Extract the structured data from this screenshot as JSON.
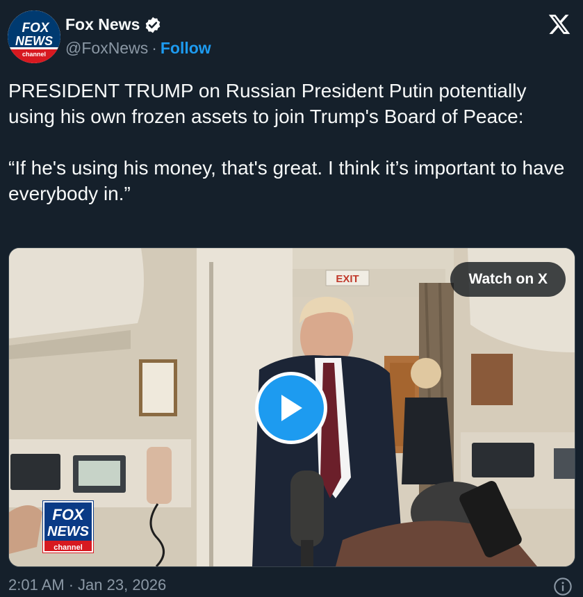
{
  "author": {
    "name": "Fox News",
    "handle": "@FoxNews",
    "separator": "·",
    "follow_label": "Follow",
    "avatar_text_top": "FOX",
    "avatar_text_mid": "NEWS",
    "avatar_text_bottom": "channel"
  },
  "platform_icon": "x-logo-icon",
  "tweet_text": "PRESIDENT TRUMP on Russian President Putin potentially using his own frozen assets to join Trump's Board of Peace:\n\n“If he's using his money, that's great. I think it’s important to have everybody in.”",
  "media": {
    "watch_label": "Watch on X",
    "exit_sign": "EXIT",
    "watermark_top": "FOX",
    "watermark_mid": "NEWS",
    "watermark_bottom": "channel"
  },
  "footer": {
    "time": "2:01 AM",
    "separator": "·",
    "date": "Jan 23, 2026",
    "info_icon": "info-icon"
  },
  "colors": {
    "background": "#15202b",
    "accent": "#1d9bf0",
    "secondary_text": "#8b98a5",
    "primary_text": "#f7f9f9",
    "fox_red": "#d71920",
    "fox_blue": "#003366"
  }
}
